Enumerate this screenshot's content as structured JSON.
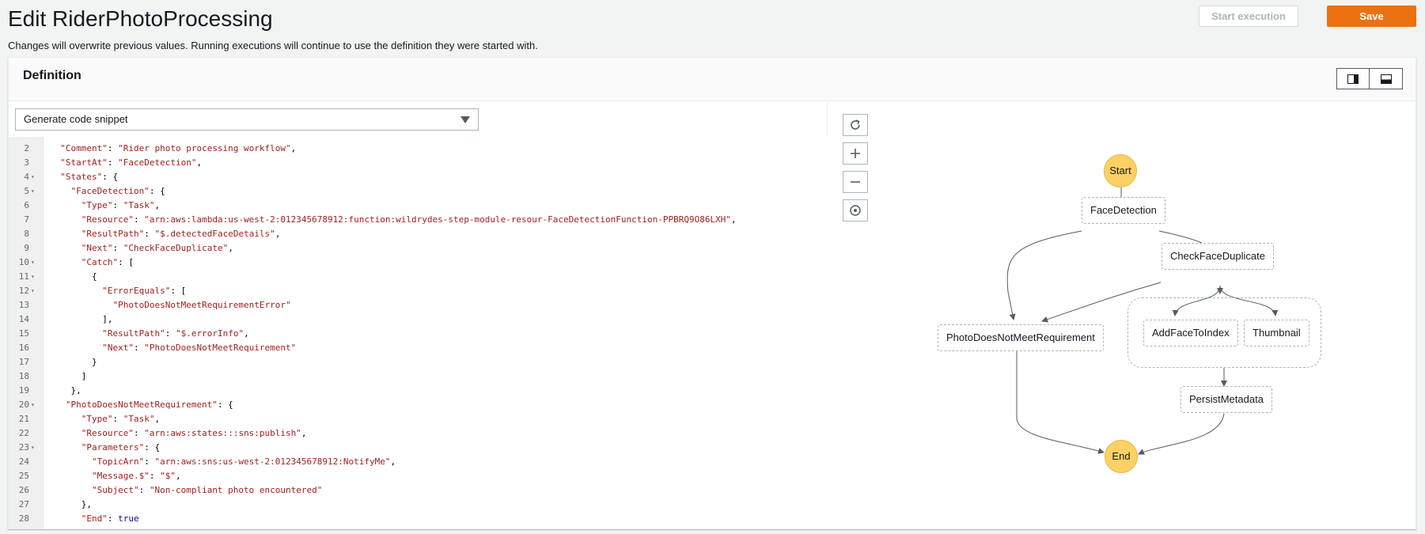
{
  "header": {
    "title": "Edit RiderPhotoProcessing",
    "description": "Changes will overwrite previous values. Running executions will continue to use the definition they were started with.",
    "start_execution_label": "Start execution",
    "save_label": "Save"
  },
  "definition": {
    "title": "Definition",
    "snippet_select": "Generate code snippet"
  },
  "code_lines": [
    {
      "n": "2",
      "fold": false,
      "tokens": [
        [
          "p",
          "  "
        ],
        [
          "k",
          "\"Comment\""
        ],
        [
          "p",
          ": "
        ],
        [
          "s",
          "\"Rider photo processing workflow\""
        ],
        [
          "p",
          ","
        ]
      ]
    },
    {
      "n": "3",
      "fold": false,
      "tokens": [
        [
          "p",
          "  "
        ],
        [
          "k",
          "\"StartAt\""
        ],
        [
          "p",
          ": "
        ],
        [
          "s",
          "\"FaceDetection\""
        ],
        [
          "p",
          ","
        ]
      ]
    },
    {
      "n": "4",
      "fold": true,
      "tokens": [
        [
          "p",
          "  "
        ],
        [
          "k",
          "\"States\""
        ],
        [
          "p",
          ": {"
        ]
      ]
    },
    {
      "n": "5",
      "fold": true,
      "tokens": [
        [
          "p",
          "    "
        ],
        [
          "k",
          "\"FaceDetection\""
        ],
        [
          "p",
          ": {"
        ]
      ]
    },
    {
      "n": "6",
      "fold": false,
      "tokens": [
        [
          "p",
          "      "
        ],
        [
          "k",
          "\"Type\""
        ],
        [
          "p",
          ": "
        ],
        [
          "s",
          "\"Task\""
        ],
        [
          "p",
          ","
        ]
      ]
    },
    {
      "n": "7",
      "fold": false,
      "tokens": [
        [
          "p",
          "      "
        ],
        [
          "k",
          "\"Resource\""
        ],
        [
          "p",
          ": "
        ],
        [
          "s",
          "\"arn:aws:lambda:us-west-2:012345678912:function:wildrydes-step-module-resour-FaceDetectionFunction-PPBRQ9O86LXH\""
        ],
        [
          "p",
          ","
        ]
      ]
    },
    {
      "n": "8",
      "fold": false,
      "tokens": [
        [
          "p",
          "      "
        ],
        [
          "k",
          "\"ResultPath\""
        ],
        [
          "p",
          ": "
        ],
        [
          "s",
          "\"$.detectedFaceDetails\""
        ],
        [
          "p",
          ","
        ]
      ]
    },
    {
      "n": "9",
      "fold": false,
      "tokens": [
        [
          "p",
          "      "
        ],
        [
          "k",
          "\"Next\""
        ],
        [
          "p",
          ": "
        ],
        [
          "s",
          "\"CheckFaceDuplicate\""
        ],
        [
          "p",
          ","
        ]
      ]
    },
    {
      "n": "10",
      "fold": true,
      "tokens": [
        [
          "p",
          "      "
        ],
        [
          "k",
          "\"Catch\""
        ],
        [
          "p",
          ": ["
        ]
      ]
    },
    {
      "n": "11",
      "fold": true,
      "tokens": [
        [
          "p",
          "        {"
        ]
      ]
    },
    {
      "n": "12",
      "fold": true,
      "tokens": [
        [
          "p",
          "          "
        ],
        [
          "k",
          "\"ErrorEquals\""
        ],
        [
          "p",
          ": ["
        ]
      ]
    },
    {
      "n": "13",
      "fold": false,
      "tokens": [
        [
          "p",
          "            "
        ],
        [
          "s",
          "\"PhotoDoesNotMeetRequirementError\""
        ]
      ]
    },
    {
      "n": "14",
      "fold": false,
      "tokens": [
        [
          "p",
          "          ],"
        ]
      ]
    },
    {
      "n": "15",
      "fold": false,
      "tokens": [
        [
          "p",
          "          "
        ],
        [
          "k",
          "\"ResultPath\""
        ],
        [
          "p",
          ": "
        ],
        [
          "s",
          "\"$.errorInfo\""
        ],
        [
          "p",
          ","
        ]
      ]
    },
    {
      "n": "16",
      "fold": false,
      "tokens": [
        [
          "p",
          "          "
        ],
        [
          "k",
          "\"Next\""
        ],
        [
          "p",
          ": "
        ],
        [
          "s",
          "\"PhotoDoesNotMeetRequirement\""
        ]
      ]
    },
    {
      "n": "17",
      "fold": false,
      "tokens": [
        [
          "p",
          "        }"
        ]
      ]
    },
    {
      "n": "18",
      "fold": false,
      "tokens": [
        [
          "p",
          "      ]"
        ]
      ]
    },
    {
      "n": "19",
      "fold": false,
      "tokens": [
        [
          "p",
          "    },"
        ]
      ]
    },
    {
      "n": "20",
      "fold": true,
      "tokens": [
        [
          "p",
          "   "
        ],
        [
          "k",
          "\"PhotoDoesNotMeetRequirement\""
        ],
        [
          "p",
          ": {"
        ]
      ]
    },
    {
      "n": "21",
      "fold": false,
      "tokens": [
        [
          "p",
          "      "
        ],
        [
          "k",
          "\"Type\""
        ],
        [
          "p",
          ": "
        ],
        [
          "s",
          "\"Task\""
        ],
        [
          "p",
          ","
        ]
      ]
    },
    {
      "n": "22",
      "fold": false,
      "tokens": [
        [
          "p",
          "      "
        ],
        [
          "k",
          "\"Resource\""
        ],
        [
          "p",
          ": "
        ],
        [
          "s",
          "\"arn:aws:states:::sns:publish\""
        ],
        [
          "p",
          ","
        ]
      ]
    },
    {
      "n": "23",
      "fold": true,
      "tokens": [
        [
          "p",
          "      "
        ],
        [
          "k",
          "\"Parameters\""
        ],
        [
          "p",
          ": {"
        ]
      ]
    },
    {
      "n": "24",
      "fold": false,
      "tokens": [
        [
          "p",
          "        "
        ],
        [
          "k",
          "\"TopicArn\""
        ],
        [
          "p",
          ": "
        ],
        [
          "s",
          "\"arn:aws:sns:us-west-2:012345678912:NotifyMe\""
        ],
        [
          "p",
          ","
        ]
      ]
    },
    {
      "n": "25",
      "fold": false,
      "tokens": [
        [
          "p",
          "        "
        ],
        [
          "k",
          "\"Message.$\""
        ],
        [
          "p",
          ": "
        ],
        [
          "s",
          "\"$\""
        ],
        [
          "p",
          ","
        ]
      ]
    },
    {
      "n": "26",
      "fold": false,
      "tokens": [
        [
          "p",
          "        "
        ],
        [
          "k",
          "\"Subject\""
        ],
        [
          "p",
          ": "
        ],
        [
          "s",
          "\"Non-compliant photo encountered\""
        ]
      ]
    },
    {
      "n": "27",
      "fold": false,
      "tokens": [
        [
          "p",
          "      },"
        ]
      ]
    },
    {
      "n": "28",
      "fold": false,
      "tokens": [
        [
          "p",
          "      "
        ],
        [
          "k",
          "\"End\""
        ],
        [
          "p",
          ": "
        ],
        [
          "kw",
          "true"
        ]
      ]
    }
  ],
  "graph": {
    "start_label": "Start",
    "end_label": "End",
    "nodes": {
      "face_detection": "FaceDetection",
      "check_face_duplicate": "CheckFaceDuplicate",
      "photo_not_meet": "PhotoDoesNotMeetRequirement",
      "add_face_to_index": "AddFaceToIndex",
      "thumbnail": "Thumbnail",
      "persist_metadata": "PersistMetadata"
    },
    "controls": [
      "refresh-icon",
      "zoom-in-icon",
      "zoom-out-icon",
      "center-icon"
    ]
  },
  "colors": {
    "save": "#ec7211",
    "state_circle": "#fcd163",
    "json_key": "#a11e1e",
    "json_keyword": "#1c007e"
  }
}
